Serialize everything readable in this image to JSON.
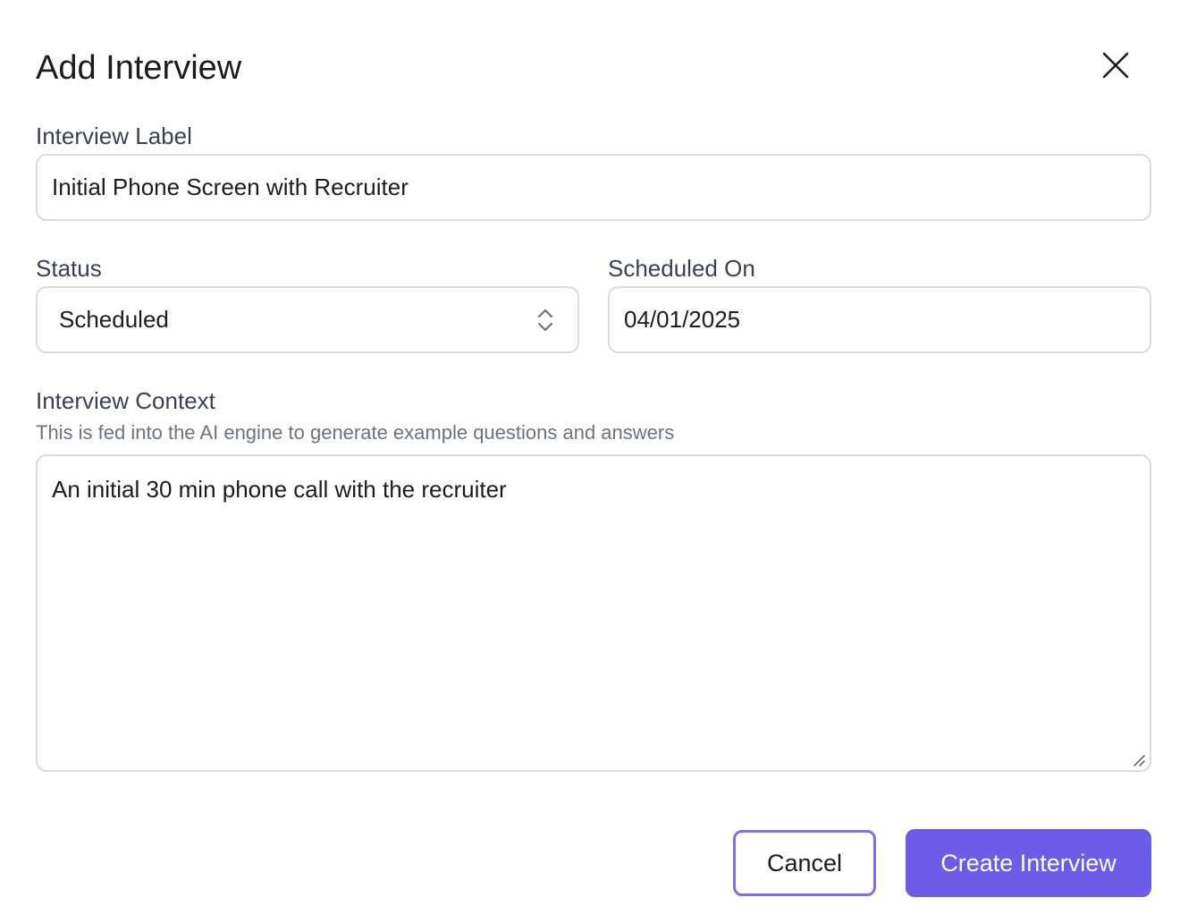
{
  "dialog": {
    "title": "Add Interview"
  },
  "icons": {
    "close": "close-icon",
    "select_arrows": "chevron-up-down-icon",
    "resize": "resize-grip-icon"
  },
  "form": {
    "interview_label": {
      "label": "Interview Label",
      "value": "Initial Phone Screen with Recruiter"
    },
    "status": {
      "label": "Status",
      "value": "Scheduled"
    },
    "scheduled_on": {
      "label": "Scheduled On",
      "value": "04/01/2025"
    },
    "interview_context": {
      "label": "Interview Context",
      "hint": "This is fed into the AI engine to generate example questions and answers",
      "value": "An initial 30 min phone call with the recruiter"
    }
  },
  "actions": {
    "cancel_label": "Cancel",
    "create_label": "Create Interview"
  },
  "colors": {
    "accent": "#6c5ce7",
    "accent_border": "#7c6cf2",
    "field_border": "#d8dbe0",
    "label_text": "#394150",
    "hint_text": "#6b7280"
  }
}
